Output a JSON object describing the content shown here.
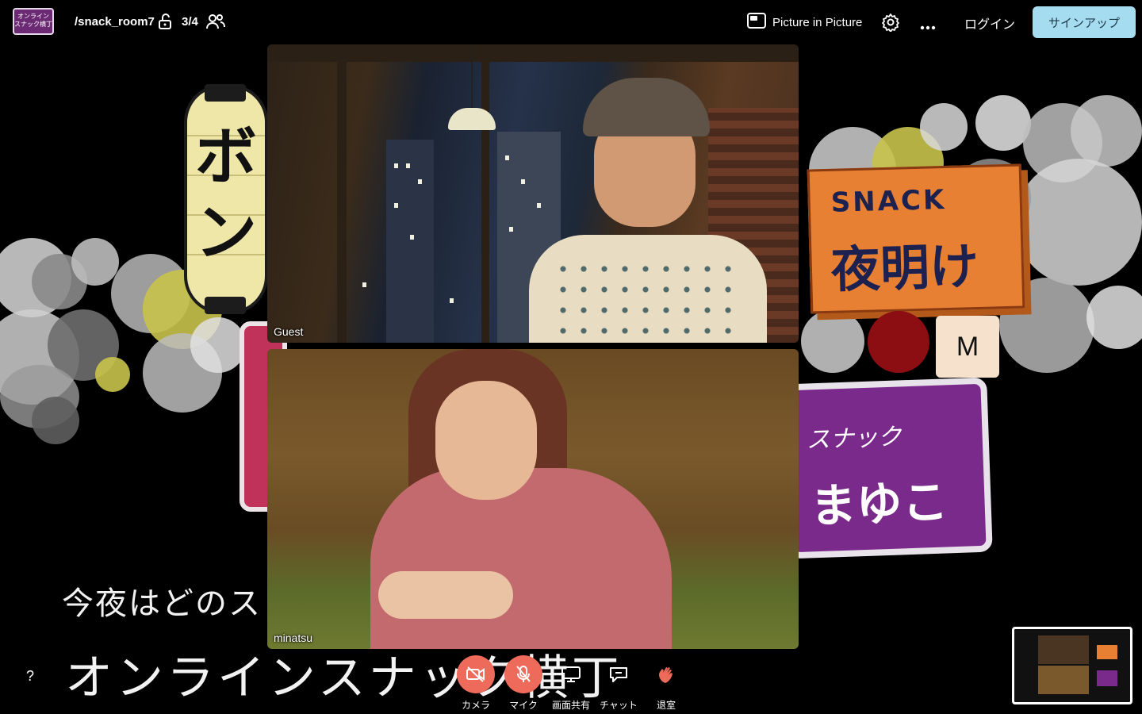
{
  "header": {
    "logo_text": "オンライン スナック横丁",
    "room_name": "/snack_room7",
    "occupancy": "3/4",
    "pip_label": "Picture in Picture",
    "login_label": "ログイン",
    "signup_label": "サインアップ"
  },
  "background": {
    "lantern_text": "ボン",
    "sign_snack_en": "SNACK",
    "sign_snack_jp": "夜明け",
    "sign_mayuko_top": "スナック",
    "sign_mayuko_main": "まゆこ",
    "tagline_line1": "今夜はどのス",
    "tagline_line2": "オンラインスナック横丁"
  },
  "participants": [
    {
      "name": "Guest"
    },
    {
      "name": "minatsu"
    }
  ],
  "avatar_initial": "M",
  "controls": {
    "help": "?",
    "camera": "カメラ",
    "mic": "マイク",
    "screen_share": "画面共有",
    "chat": "チャット",
    "leave": "退室"
  },
  "colors": {
    "accent_off": "#ee6a5a",
    "signup_bg": "#a6dcf0",
    "yoake_sign": "#e88034",
    "mayuko_sign": "#7a2a8a"
  }
}
